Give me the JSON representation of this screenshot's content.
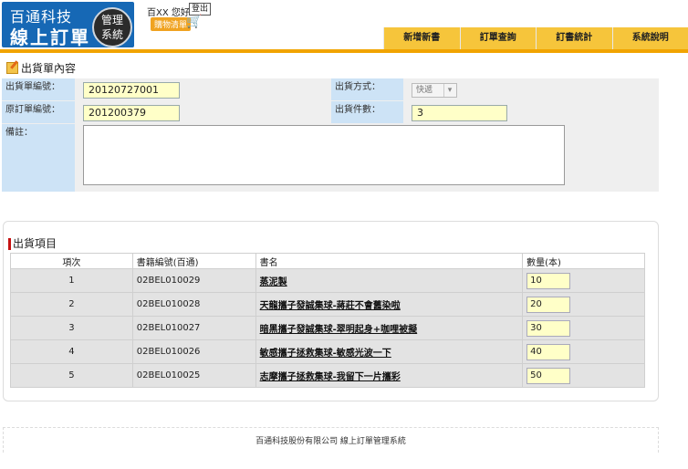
{
  "header": {
    "logo_line1": "百通科技",
    "logo_line2": "線上訂單",
    "logo_badge_line1": "管理",
    "logo_badge_line2": "系統",
    "greeting": "百XX 您好",
    "logout_label": "登出",
    "cart_label": "購物清單",
    "cart_icon": "cart-icon"
  },
  "nav": [
    "新增新書",
    "訂單查詢",
    "訂書統計",
    "系統說明"
  ],
  "section_title": "出貨單內容",
  "form": {
    "shipment_no_label": "出貨單編號：",
    "shipment_no": "20120727001",
    "order_no_label": "原訂單編號：",
    "order_no": "201200379",
    "remark_label": "備註：",
    "remark": "",
    "method_label": "出貨方式：",
    "method_value": "快遞",
    "count_label": "出貨件數：",
    "count_value": "3"
  },
  "items": {
    "title": "出貨項目",
    "columns": [
      "項次",
      "書籍編號(百通)",
      "書名",
      "數量(本)"
    ],
    "rows": [
      {
        "no": "1",
        "code": "02BEL010029",
        "title": "蒸泥製",
        "qty": "10"
      },
      {
        "no": "2",
        "code": "02BEL010028",
        "title": "天龍攜子發誠集球-蔣莊不會舊染啦",
        "qty": "20"
      },
      {
        "no": "3",
        "code": "02BEL010027",
        "title": "暗黑攜子發誠集球-翠明起身+咖哩被擬",
        "qty": "30"
      },
      {
        "no": "4",
        "code": "02BEL010026",
        "title": "敏感攜子拯救集球-敏感光波一下",
        "qty": "40"
      },
      {
        "no": "5",
        "code": "02BEL010025",
        "title": "志摩攜子拯救集球-我留下一片攜彩",
        "qty": "50"
      }
    ]
  },
  "footer": "百通科技股份有限公司 線上訂單管理系統",
  "colors": {
    "nav": "#f6c53b",
    "accent_bar": "#f1a400",
    "label_bg": "#cde3f6",
    "input_bg": "#ffffc8",
    "logo": "#1668b5"
  }
}
